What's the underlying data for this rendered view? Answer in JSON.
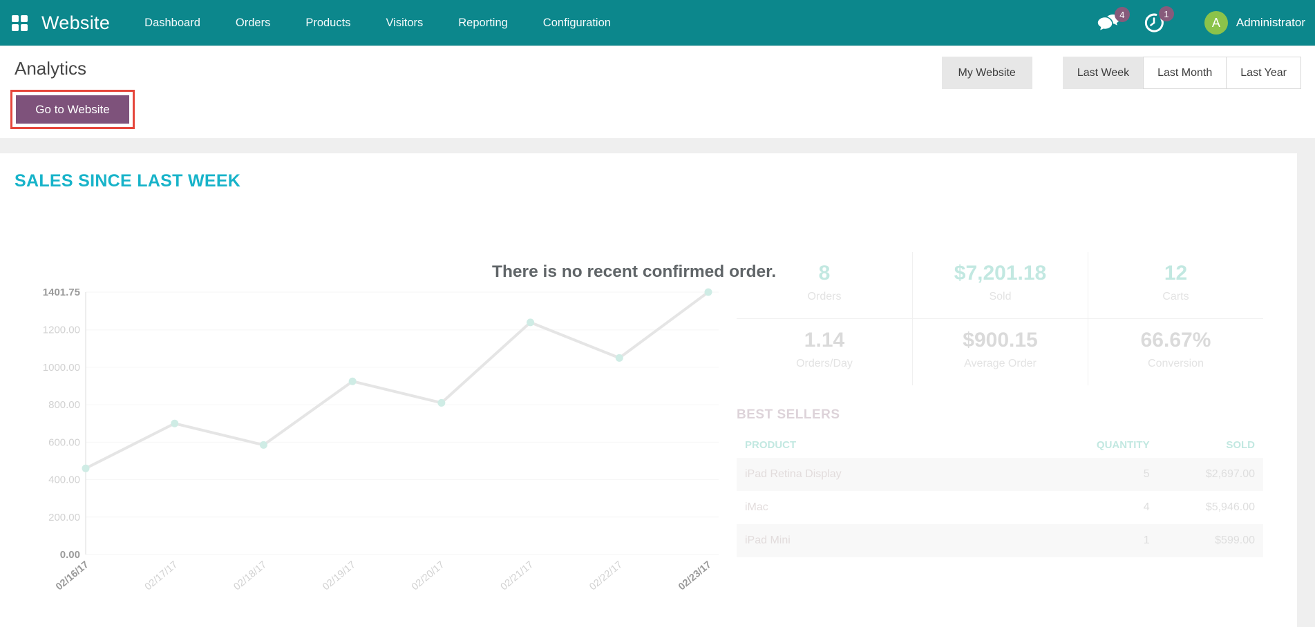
{
  "colors": {
    "navbar": "#0C878C",
    "teal": "#17B3C9",
    "purple": "#7E527B",
    "red": "#E5463B",
    "badge": "#875A7B",
    "avatar": "#8BC34A"
  },
  "navbar": {
    "app_name": "Website",
    "menu_items": [
      "Dashboard",
      "Orders",
      "Products",
      "Visitors",
      "Reporting",
      "Configuration"
    ],
    "messages_badge": "4",
    "activities_badge": "1",
    "user": {
      "initial": "A",
      "name": "Administrator"
    }
  },
  "control_panel": {
    "title": "Analytics",
    "website_switcher": "My Website",
    "range_buttons": [
      {
        "label": "Last Week",
        "active": true
      },
      {
        "label": "Last Month",
        "active": false
      },
      {
        "label": "Last Year",
        "active": false
      }
    ],
    "go_to_website": "Go to Website"
  },
  "dashboard": {
    "section_title": "SALES SINCE LAST WEEK",
    "empty_message": "There is no recent confirmed order.",
    "stats": [
      {
        "value": "8",
        "label": "Orders",
        "accent": true
      },
      {
        "value": "$7,201.18",
        "label": "Sold",
        "accent": true
      },
      {
        "value": "12",
        "label": "Carts",
        "accent": true
      },
      {
        "value": "1.14",
        "label": "Orders/Day",
        "accent": false
      },
      {
        "value": "$900.15",
        "label": "Average Order",
        "accent": false
      },
      {
        "value": "66.67%",
        "label": "Conversion",
        "accent": false
      }
    ],
    "best_sellers": {
      "title": "BEST SELLERS",
      "columns": [
        "PRODUCT",
        "QUANTITY",
        "SOLD"
      ],
      "rows": [
        [
          "iPad Retina Display",
          "5",
          "$2,697.00"
        ],
        [
          "iMac",
          "4",
          "$5,946.00"
        ],
        [
          "iPad Mini",
          "1",
          "$599.00"
        ]
      ]
    }
  },
  "chart_data": {
    "type": "line",
    "title": "",
    "xlabel": "",
    "ylabel": "",
    "x": [
      "02/16/17",
      "02/17/17",
      "02/18/17",
      "02/19/17",
      "02/20/17",
      "02/21/17",
      "02/22/17",
      "02/23/17"
    ],
    "series": [
      {
        "values": [
          460,
          700,
          585,
          925,
          810,
          1240,
          1050,
          1401.75
        ]
      }
    ],
    "ylim": [
      0,
      1401.75
    ],
    "yticks": [
      0,
      200,
      400,
      600,
      800,
      1000,
      1200,
      1401.75
    ],
    "bold_yticks": [
      0,
      1401.75
    ],
    "bold_xticks": [
      "02/16/17",
      "02/23/17"
    ],
    "grid": true,
    "legend": "none",
    "line_color": "#e5e5e5",
    "point_color": "#cfece5"
  }
}
